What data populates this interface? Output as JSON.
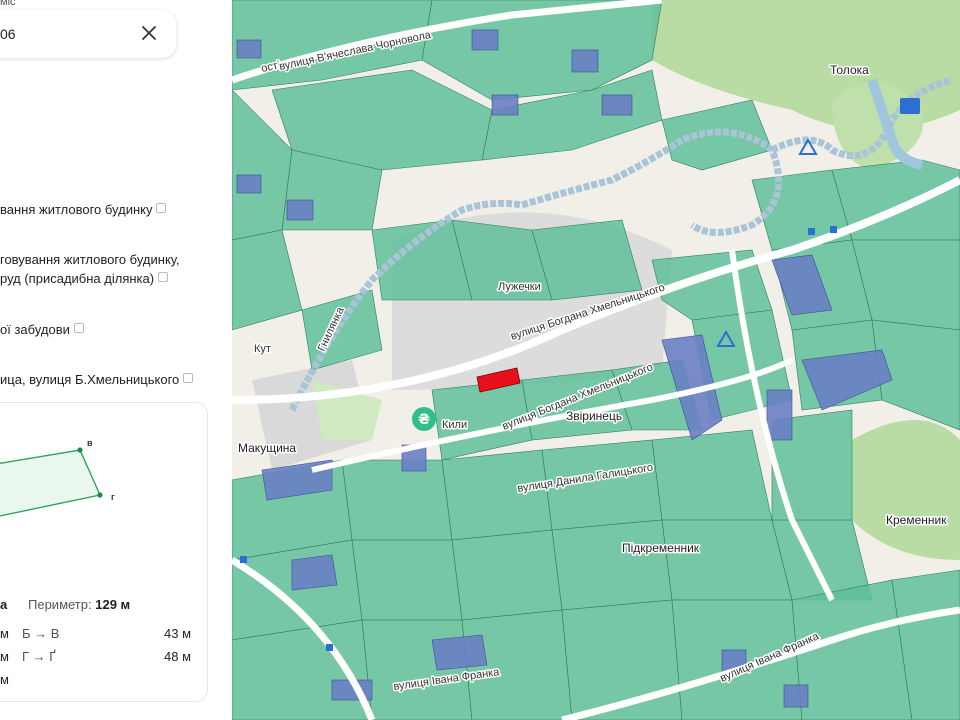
{
  "panel": {
    "top_label": "міс",
    "search_value": "06",
    "info": {
      "purpose_1": "вання житлового будинку",
      "purpose_2a": "говування житлового будинку,",
      "purpose_2b": "руд (присадибна ділянка)",
      "category": "ої забудови",
      "address": "ица, вулиця Б.Хмельницького"
    },
    "plan": {
      "vertex_v": "в",
      "vertex_g": "г"
    },
    "stats": {
      "area_fragment": "а",
      "perimeter_label": "Периметр:",
      "perimeter_value": "129 м",
      "row1_left": "м",
      "row1_side": "Б → В",
      "row1_len": "43 м",
      "row2_left": "м",
      "row2_side": "Г → Ґ",
      "row2_len": "48 м",
      "row3_left": "м"
    }
  },
  "map": {
    "labels": {
      "street_chornovola": "вулиця В'ячеслава Чорновола",
      "street_chornovola_prefix": "ості",
      "toloka": "Толока",
      "luzhky": "Лужечки",
      "street_khmelnytskoho_1": "вулиця Богдана Хмельницького",
      "street_khmelnytskoho_2": "вулиця Богдана Хмельницького",
      "zvirynets": "Звіринець",
      "street_halytskoho": "вулиця Данила Галицького",
      "makushchyna": "Макущина",
      "pidkremennyk": "Підкременник",
      "kremennyk": "Кременник",
      "street_franka_1": "вулиця Івана Франка",
      "street_franka_2": "вулиця Івана Франка",
      "kyly": "Кили",
      "kut": "Кут",
      "river": "Гнилянка"
    },
    "icons": [
      "hryvnia-icon",
      "campsite-icon",
      "swimming-icon",
      "bus-stop-icon"
    ],
    "colors": {
      "parcel_green": "#5fbf9a",
      "parcel_blue": "#6a7fc4",
      "selected_parcel": "#e8101a",
      "forest": "#b7dba1",
      "river": "#a9c4d6"
    }
  }
}
